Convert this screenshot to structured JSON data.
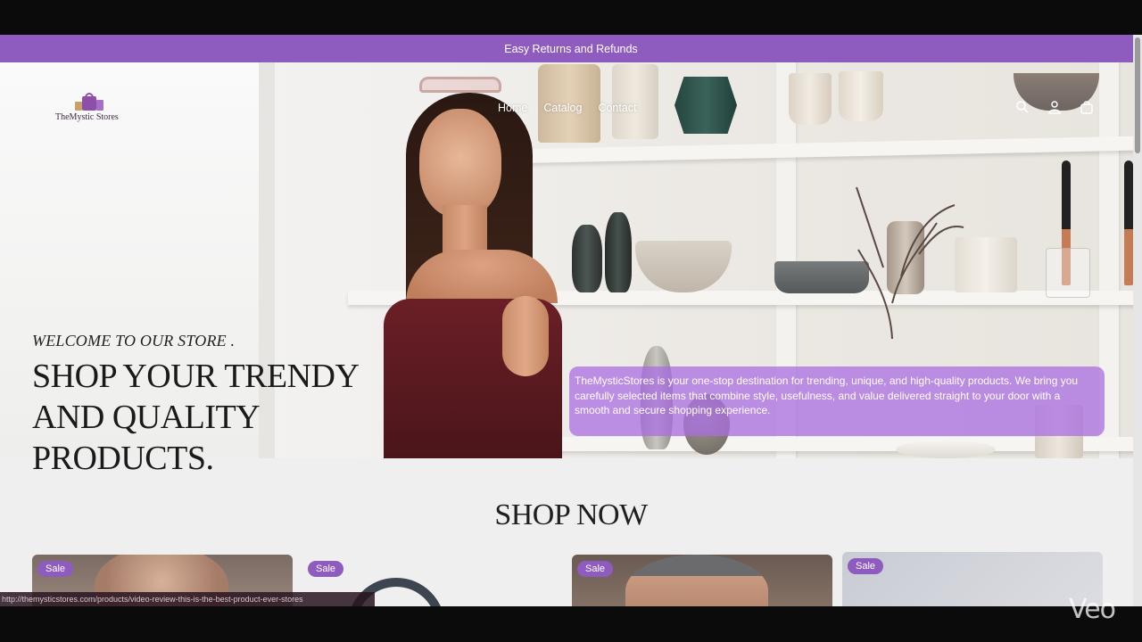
{
  "announcement": {
    "text": "Easy Returns and Refunds"
  },
  "header": {
    "logo_text": "TheMystic Stores",
    "nav": [
      {
        "label": "Home"
      },
      {
        "label": "Catalog"
      },
      {
        "label": "Contact"
      }
    ],
    "icons": [
      "search-icon",
      "account-icon",
      "cart-icon"
    ]
  },
  "hero": {
    "subtitle": "WELCOME TO OUR STORE .",
    "title": "SHOP YOUR TRENDY AND QUALITY PRODUCTS.",
    "description": "TheMysticStores is your one-stop destination for trending, unique, and high-quality products. We bring you carefully selected items that combine style, usefulness, and value delivered straight to your door with a smooth and secure shopping experience."
  },
  "section": {
    "title": "SHOP NOW"
  },
  "products": [
    {
      "badge": "Sale"
    },
    {
      "badge": "Sale"
    },
    {
      "badge": "Sale"
    },
    {
      "badge": "Sale"
    }
  ],
  "overlay": {
    "ticker": "http://themysticstores.com/products/video-review-this-is-the-best-product-ever-stores",
    "watermark": "Veo"
  },
  "colors": {
    "accent": "#8e5bbf",
    "background": "#efefef",
    "text": "#1a1a1a"
  }
}
